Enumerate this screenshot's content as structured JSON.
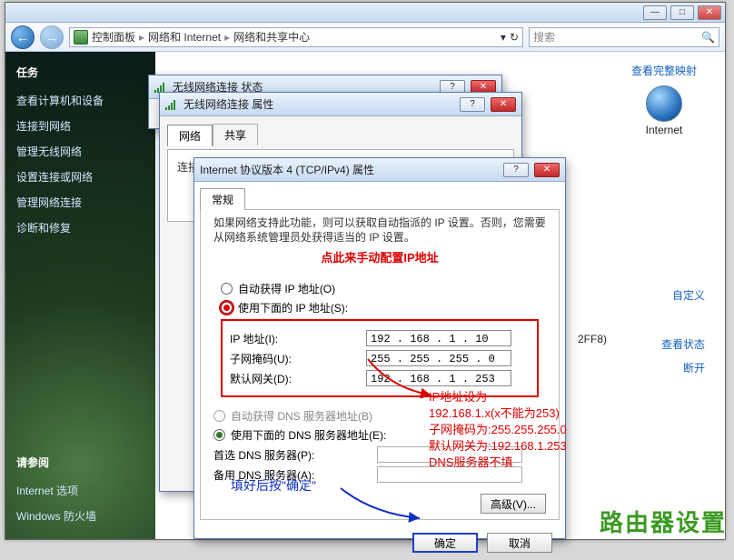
{
  "window": {
    "min": "—",
    "max": "□",
    "close": "✕"
  },
  "nav": {
    "back": "←",
    "fwd": "→"
  },
  "breadcrumb": {
    "root": "控制面板",
    "mid": "网络和 Internet",
    "leaf": "网络和共享中心",
    "sep": "▸",
    "refresh": "↻",
    "dd": "▾"
  },
  "search": {
    "placeholder": "搜索",
    "icon": "🔍"
  },
  "sidebar": {
    "heading": "任务",
    "items": [
      "查看计算机和设备",
      "连接到网络",
      "管理无线网络",
      "设置连接或网络",
      "管理网络连接",
      "诊断和修复"
    ],
    "see_also": "请参阅",
    "extras": [
      "Internet 选项",
      "Windows 防火墙"
    ]
  },
  "content": {
    "map_link": "查看完整映射",
    "internet_label": "Internet",
    "custom_link": "自定义",
    "status_link": "查看状态",
    "disconnect_link": "断开",
    "ssid_fragment": "2FF8)"
  },
  "dlg1": {
    "title": "无线网络连接 状态"
  },
  "dlg2": {
    "title": "无线网络连接 属性",
    "tabs": [
      "网络",
      "共享"
    ],
    "stub": "连接时使用"
  },
  "dlg3": {
    "title": "Internet 协议版本 4 (TCP/IPv4) 属性",
    "tab": "常规",
    "desc": "如果网络支持此功能，则可以获取自动指派的 IP 设置。否则，您需要从网络系统管理员处获得适当的 IP 设置。",
    "radio_auto_ip": "自动获得 IP 地址(O)",
    "radio_manual_ip": "使用下面的 IP 地址(S):",
    "ip_label": "IP 地址(I):",
    "mask_label": "子网掩码(U):",
    "gw_label": "默认网关(D):",
    "ip_value": "192 . 168 .  1  . 10",
    "mask_value": "255 . 255 . 255 .  0",
    "gw_value": "192 . 168 .  1  . 253",
    "radio_auto_dns": "自动获得 DNS 服务器地址(B)",
    "radio_manual_dns": "使用下面的 DNS 服务器地址(E):",
    "dns1_label": "首选 DNS 服务器(P):",
    "dns2_label": "备用 DNS 服务器(A):",
    "adv_btn": "高级(V)...",
    "ok_btn": "确定",
    "cancel_btn": "取消"
  },
  "annot": {
    "red_heading": "点此来手动配置IP地址",
    "red_block_l1": "IP地址设为",
    "red_block_l2": "192.168.1.x(x不能为253)",
    "red_block_l3": "子网掩码为:255.255.255.0",
    "red_block_l4": "默认网关为:192.168.1.253",
    "red_block_l5": "DNS服务器不填",
    "blue_text": "填好后按\"确定\""
  },
  "watermark": "路由器设置"
}
